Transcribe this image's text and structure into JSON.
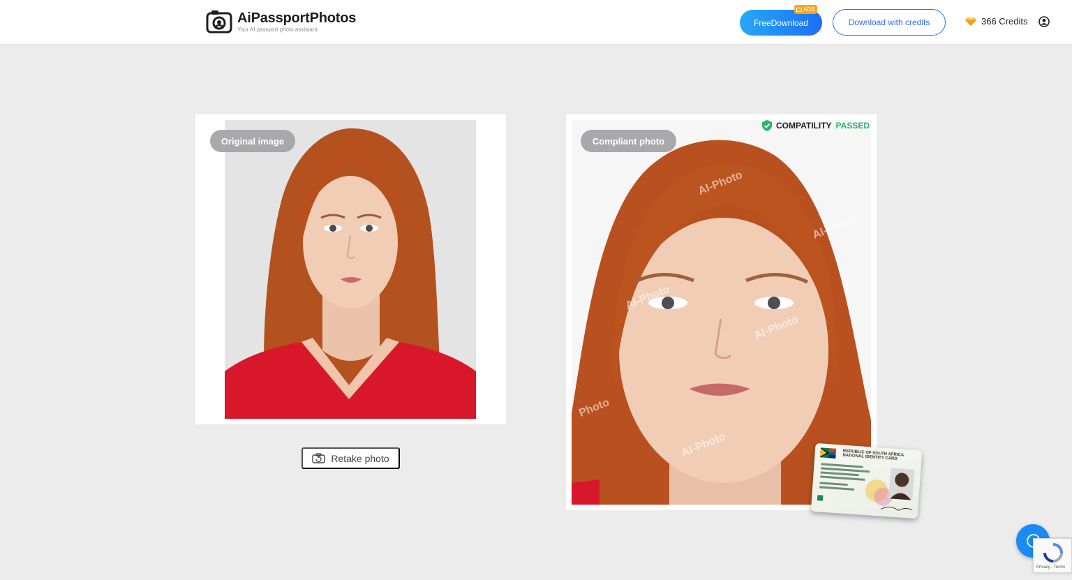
{
  "header": {
    "logo_title": "AiPassportPhotos",
    "logo_subtitle": "Your AI passport photo assistant.",
    "free_download_label": "FreeDownload",
    "ads_badge": "ADS",
    "download_credits_label": "Download with credits",
    "credits_text": "366 Credits"
  },
  "original": {
    "pill_label": "Original image",
    "retake_label": "Retake photo"
  },
  "compliant": {
    "pill_label": "Compliant photo",
    "status_prefix": "COMPATILITY",
    "status_suffix": "PASSED",
    "watermark": "AI-Photo",
    "watermark_partial": "Photo"
  },
  "id_card": {
    "title": "REPUBLIC OF SOUTH AFRICA NATIONAL IDENTITY CARD"
  },
  "recaptcha": {
    "text": "Privacy - Terms"
  },
  "colors": {
    "accent_blue": "#2f6df6",
    "passed_green": "#2bb46b",
    "ads_orange": "#f6a623",
    "shirt_red": "#d8182a",
    "hair": "#b8501e"
  }
}
